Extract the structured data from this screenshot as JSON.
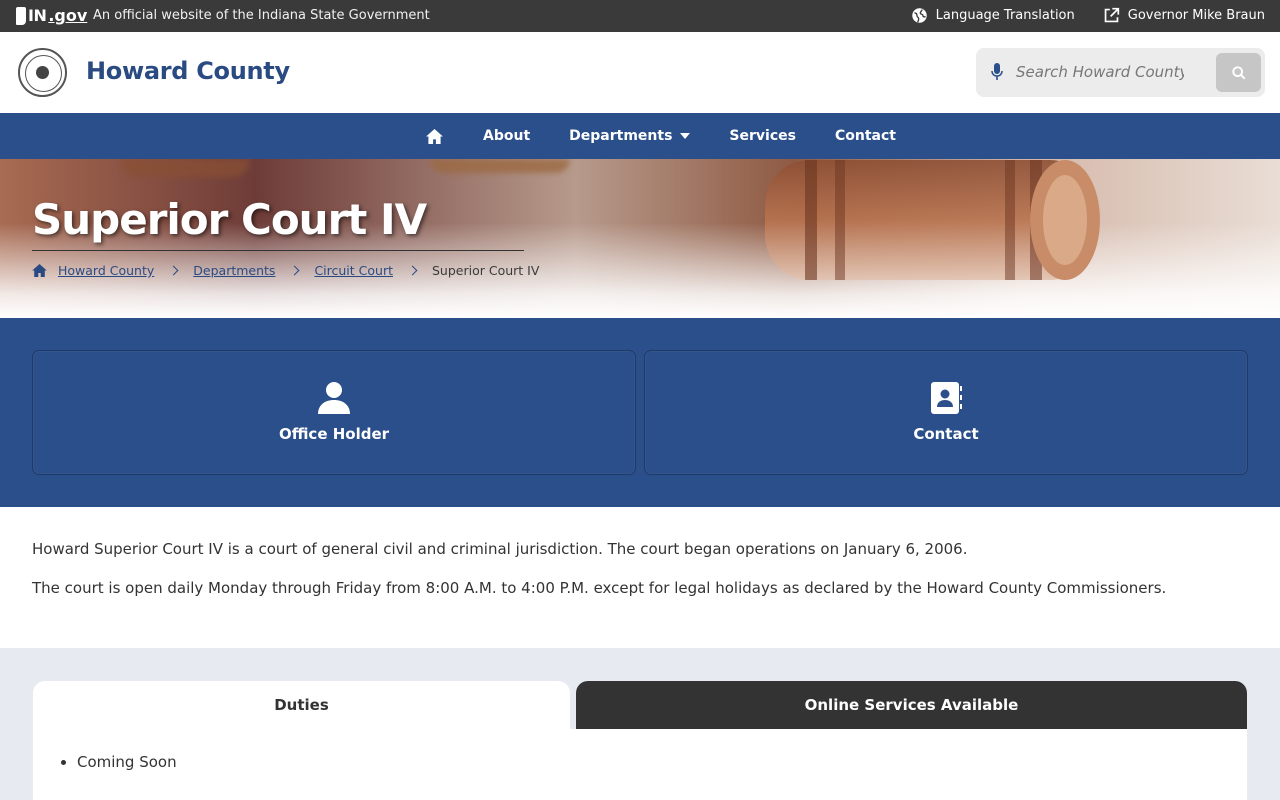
{
  "gov_bar": {
    "logo_state": "IN",
    "logo_gov": ".gov",
    "official_text": "An official website of the Indiana State Government",
    "language_link": "Language Translation",
    "governor_link": "Governor Mike Braun"
  },
  "header": {
    "site_title": "Howard County",
    "search_placeholder": "Search Howard County"
  },
  "nav": {
    "items": [
      {
        "label": "About"
      },
      {
        "label": "Departments"
      },
      {
        "label": "Services"
      },
      {
        "label": "Contact"
      }
    ]
  },
  "hero": {
    "title": "Superior Court IV",
    "breadcrumb": [
      "Howard County",
      "Departments",
      "Circuit Court",
      "Superior Court IV"
    ]
  },
  "cards": [
    {
      "label": "Office Holder",
      "icon": "person-icon"
    },
    {
      "label": "Contact",
      "icon": "address-book-icon"
    }
  ],
  "description": [
    "Howard Superior Court IV is a court of general civil and criminal jurisdiction. The court began operations on January 6, 2006.",
    "The court is open daily Monday through Friday from 8:00 A.M. to 4:00 P.M. except for legal holidays as declared by the Howard County Commissioners."
  ],
  "tabs": {
    "duties_label": "Duties",
    "online_label": "Online Services Available",
    "duties_items": [
      "Coming Soon"
    ]
  },
  "colors": {
    "brand_blue": "#2b4f8a",
    "gov_bar": "#3a3a3a",
    "title_blue": "#2a4a82"
  }
}
